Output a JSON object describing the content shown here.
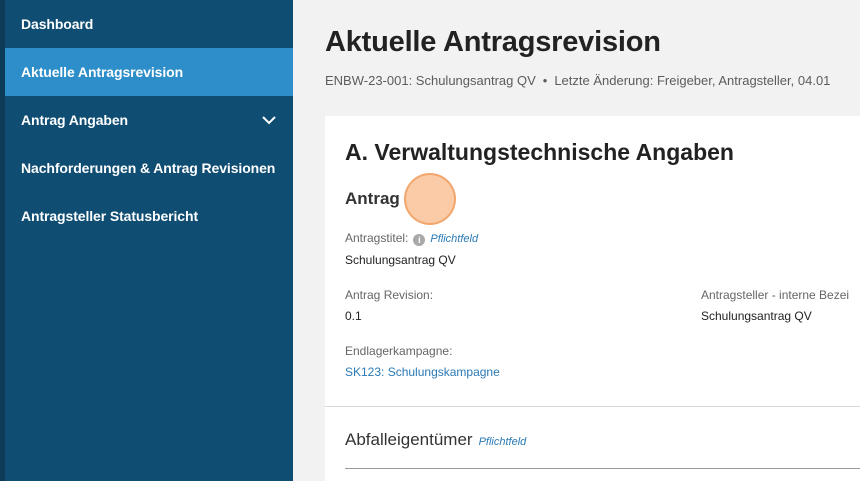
{
  "sidebar": {
    "items": [
      {
        "label": "Dashboard"
      },
      {
        "label": "Aktuelle Antragsrevision"
      },
      {
        "label": "Antrag Angaben"
      },
      {
        "label": "Nachforderungen & Antrag Revisionen"
      },
      {
        "label": "Antragsteller Statusbericht"
      }
    ],
    "active_index": 1
  },
  "header": {
    "title": "Aktuelle Antragsrevision",
    "subtitle_left": "ENBW-23-001: Schulungsantrag QV",
    "subtitle_sep": "•",
    "subtitle_right": "Letzte Änderung: Freigeber, Antragsteller, 04.01"
  },
  "section": {
    "title": "A. Verwaltungstechnische Angaben",
    "subheading": "Antrag",
    "required_label": "Pflichtfeld",
    "fields": {
      "antragstitel": {
        "label": "Antragstitel:",
        "value": "Schulungsantrag QV"
      },
      "revision": {
        "label": "Antrag Revision:",
        "value": "0.1"
      },
      "interne_bezeichnung": {
        "label": "Antragsteller - interne Bezei",
        "value": "Schulungsantrag QV"
      },
      "kampagne": {
        "label": "Endlagerkampagne:",
        "value": "SK123: Schulungskampagne"
      }
    }
  },
  "owner": {
    "title": "Abfalleigentümer",
    "required_label": "Pflichtfeld"
  },
  "icons": {
    "expand": "chevron-down-icon",
    "info": "info-icon"
  },
  "colors": {
    "sidebar_bg": "#0f4d73",
    "sidebar_active": "#2d8ec9",
    "link": "#2a7ab5",
    "cursor_highlight": "#f8b784"
  }
}
